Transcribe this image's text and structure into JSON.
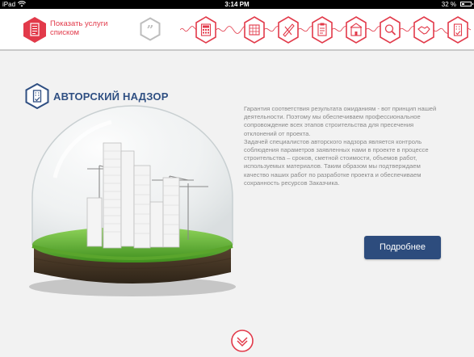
{
  "status_bar": {
    "carrier": "iPad",
    "time": "3:14 PM",
    "battery": "32 %",
    "battery_level": 0.32
  },
  "header": {
    "show_services_label": "Показать услуги списком",
    "nav_icons": [
      "calculator-icon",
      "blueprint-icon",
      "ruler-icon",
      "clipboard-icon",
      "building-icon",
      "magnifier-icon",
      "handshake-icon",
      "building-check-icon"
    ]
  },
  "main": {
    "title": "АВТОРСКИЙ НАДЗОР",
    "description": [
      "Гарантия соответствия результата ожиданиям - вот принцип нашей деятельности. Поэтому мы обеспечиваем профессиональное сопровождение всех этапов  строительства для пресечения отклонений от проекта.",
      "Задачей специалистов авторского надзора является контроль соблюдения параметров заявленных нами в проекте в процессе строительства – сроков, сметной стоимости, объемов работ, используемых материалов. Таким образом мы подтверждаем качество наших работ по разработке проекта и обеспечиваем сохранность ресурсов Заказчика."
    ],
    "more_button": "Подробнее"
  },
  "colors": {
    "accent_red": "#e23a4a",
    "title_blue": "#2f4f82",
    "button_blue": "#2d4c7d"
  }
}
